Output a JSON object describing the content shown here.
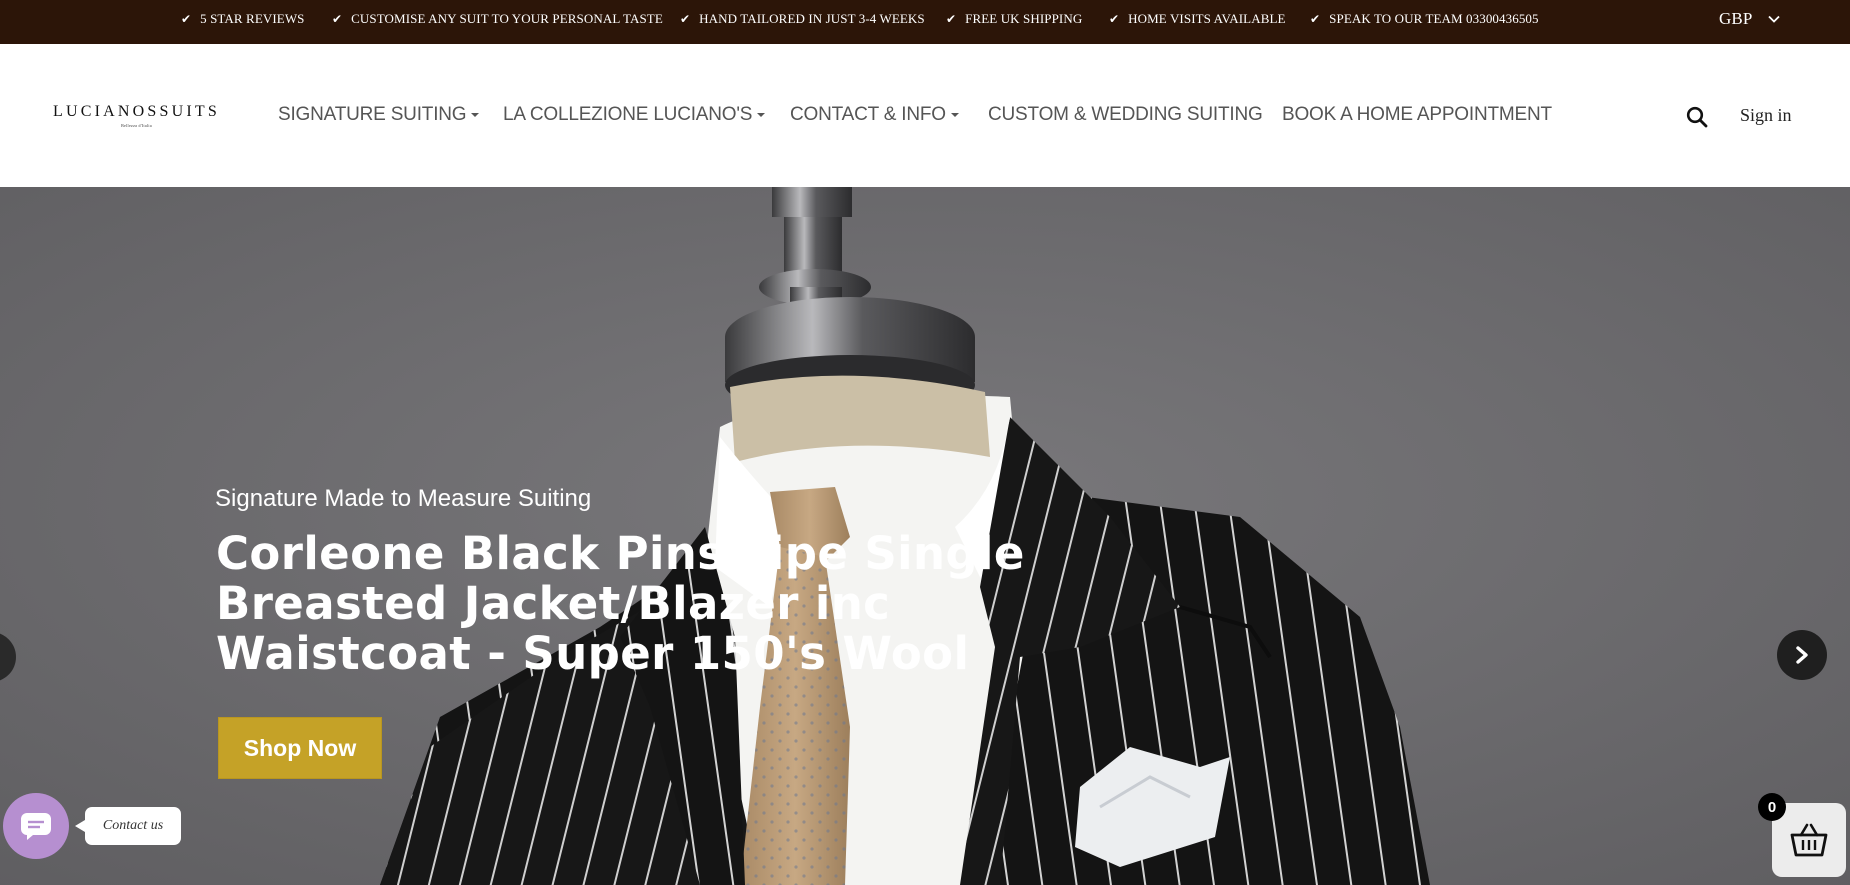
{
  "topbar": {
    "usps": [
      "5 STAR REVIEWS",
      "CUSTOMISE ANY SUIT TO YOUR PERSONAL TASTE",
      "HAND TAILORED IN JUST 3-4 WEEKS",
      "FREE UK SHIPPING",
      "HOME VISITS AVAILABLE",
      "SPEAK TO OUR TEAM 03300436505"
    ],
    "currency": "GBP"
  },
  "header": {
    "logo_text": "LUCIANOSSUITS",
    "logo_tagline": "Bellezza d'Italia",
    "nav": [
      {
        "label": "SIGNATURE SUITING",
        "dropdown": true
      },
      {
        "label": "LA COLLEZIONE LUCIANO'S",
        "dropdown": true
      },
      {
        "label": "CONTACT & INFO",
        "dropdown": true
      },
      {
        "label": "CUSTOM & WEDDING SUITING",
        "dropdown": false
      },
      {
        "label": "BOOK A HOME APPOINTMENT",
        "dropdown": false
      }
    ],
    "sign_in": "Sign in"
  },
  "hero": {
    "subtitle": "Signature Made to Measure Suiting",
    "title": "Corleone Black Pinstripe Single Breasted Jacket/Blazer inc Waistcoat - Super 150's Wool",
    "cta": "Shop Now"
  },
  "widgets": {
    "contact_label": "Contact us",
    "cart_count": "0"
  },
  "colors": {
    "topbar_bg": "#2c1508",
    "cta_bg": "#c5a227",
    "hero_bg": "#6e6d70",
    "chat_bubble": "#b68fd0"
  }
}
